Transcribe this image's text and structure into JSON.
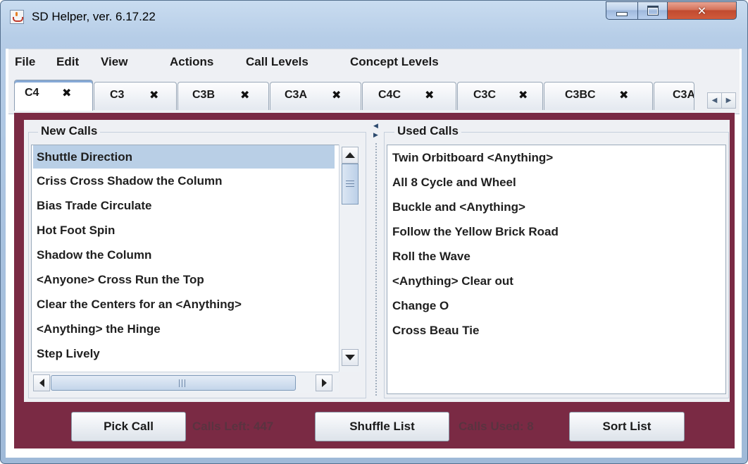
{
  "window": {
    "title": "SD Helper, ver. 6.17.22",
    "controls": {
      "minimize": "minimize",
      "maximize": "maximize",
      "close": "✕"
    }
  },
  "menu": [
    "File",
    "Edit",
    "View",
    "Actions",
    "Call Levels",
    "Concept Levels"
  ],
  "tabs": [
    {
      "label": "C4",
      "close": "✖",
      "active": true
    },
    {
      "label": "C3",
      "close": "✖"
    },
    {
      "label": "C3B",
      "close": "✖"
    },
    {
      "label": "C3A",
      "close": "✖"
    },
    {
      "label": "C4C",
      "close": "✖"
    },
    {
      "label": "C3C",
      "close": "✖"
    },
    {
      "label": "C3BC",
      "close": "✖"
    },
    {
      "label": "C3A",
      "close": ""
    }
  ],
  "new_calls": {
    "title": "New Calls",
    "items": [
      "Shuttle Direction",
      "Criss Cross Shadow the Column",
      "Bias Trade Circulate",
      "Hot Foot Spin",
      "Shadow the Column",
      "<Anyone> Cross Run the Top",
      "Clear the Centers for an <Anything>",
      "<Anything> the Hinge",
      "Step Lively"
    ],
    "selected_index": 0
  },
  "used_calls": {
    "title": "Used Calls",
    "items": [
      "Twin Orbitboard <Anything>",
      "All 8 Cycle and Wheel",
      "Buckle and <Anything>",
      "Follow the Yellow Brick Road",
      "Roll the Wave",
      "<Anything> Clear out",
      "Change O",
      "Cross Beau Tie"
    ]
  },
  "bottom": {
    "pick_call": "Pick Call",
    "calls_left": "Calls Left: 447",
    "shuffle_list": "Shuffle List",
    "calls_used": "Calls Used: 8",
    "sort_list": "Sort List"
  },
  "colors": {
    "panel": "#7a2a44",
    "selection": "#b9cfe6",
    "counter_text": "#5a3340"
  }
}
